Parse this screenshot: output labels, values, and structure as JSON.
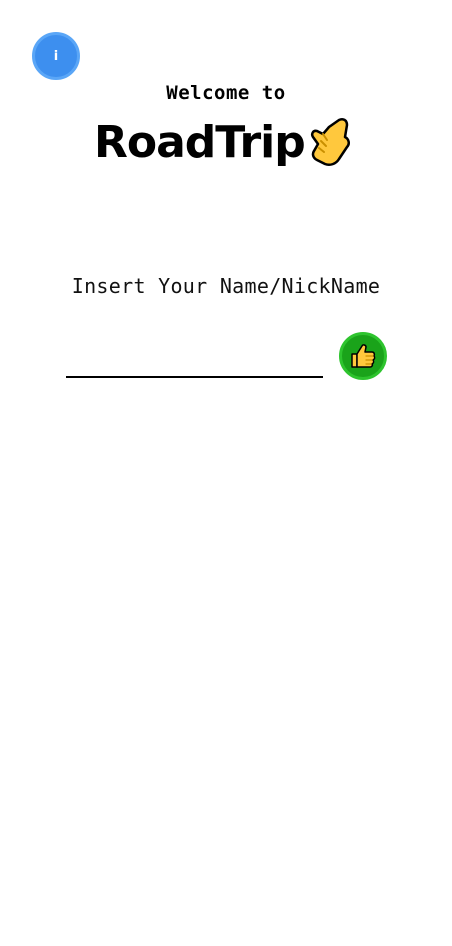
{
  "info_button": {
    "label": "i",
    "icon": "info-icon",
    "color": "#3d8fef"
  },
  "header": {
    "welcome": "Welcome to",
    "brand": "RoadTrip",
    "brand_icon": "call-me-hand-icon"
  },
  "form": {
    "prompt": "Insert Your Name/NickName",
    "name_value": "",
    "name_placeholder": "",
    "submit_icon": "thumbs-up-icon",
    "submit_color": "#1aa31a"
  }
}
